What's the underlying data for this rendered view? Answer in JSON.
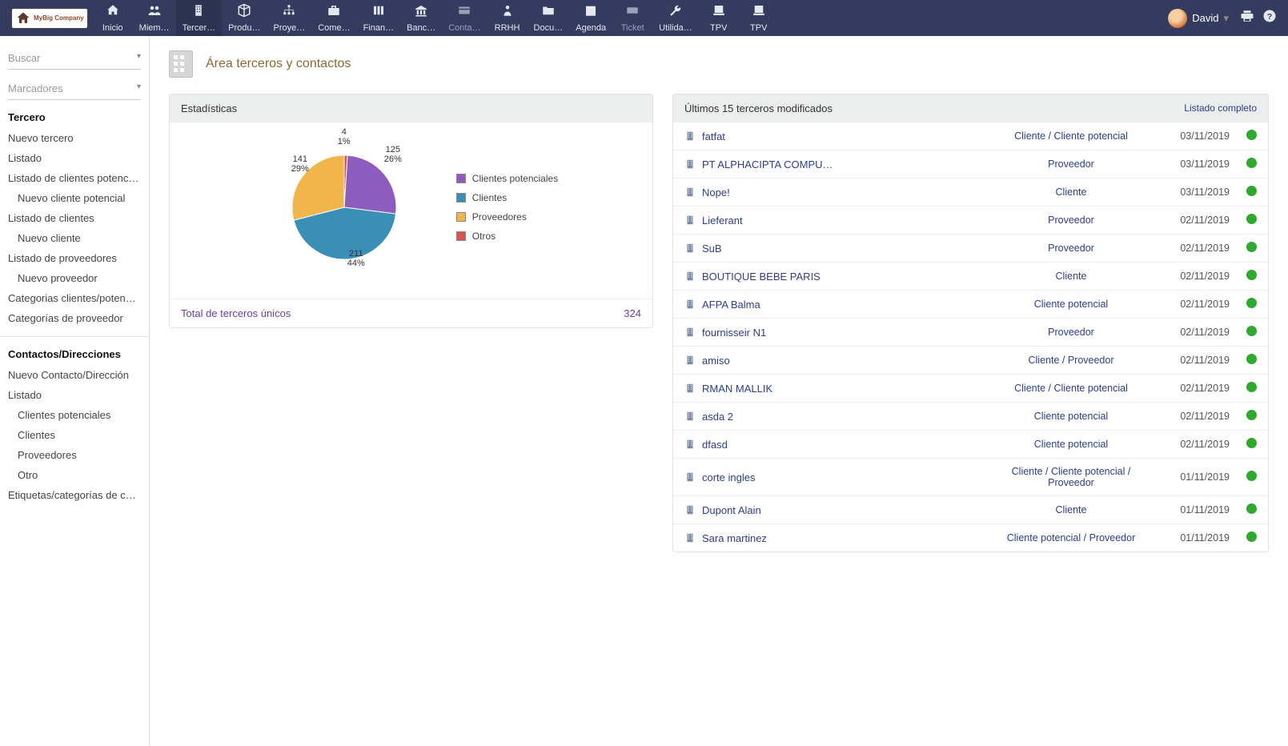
{
  "brand": "MyBig Company",
  "nav": [
    {
      "label": "Inicio",
      "icon": "home"
    },
    {
      "label": "Miem…",
      "icon": "users"
    },
    {
      "label": "Tercer…",
      "icon": "building",
      "active": true
    },
    {
      "label": "Produ…",
      "icon": "box"
    },
    {
      "label": "Proye…",
      "icon": "sitemap"
    },
    {
      "label": "Come…",
      "icon": "briefcase"
    },
    {
      "label": "Finan…",
      "icon": "books"
    },
    {
      "label": "Banc…",
      "icon": "bank"
    },
    {
      "label": "Conta…",
      "icon": "card",
      "muted": true
    },
    {
      "label": "RRHH",
      "icon": "usertie"
    },
    {
      "label": "Docu…",
      "icon": "folder"
    },
    {
      "label": "Agenda",
      "icon": "calendar"
    },
    {
      "label": "Ticket",
      "icon": "ticket",
      "muted": true
    },
    {
      "label": "Utilida…",
      "icon": "wrench"
    },
    {
      "label": "TPV",
      "icon": "register"
    },
    {
      "label": "TPV",
      "icon": "register"
    }
  ],
  "user": {
    "name": "David"
  },
  "search": {
    "placeholder": "Buscar"
  },
  "bookmarks": {
    "placeholder": "Marcadores"
  },
  "sidebar": {
    "groups": [
      {
        "head": "Tercero",
        "items": [
          {
            "label": "Nuevo tercero"
          },
          {
            "label": "Listado"
          },
          {
            "label": "Listado de clientes potenci…"
          },
          {
            "label": "Nuevo cliente potencial",
            "indent": true
          },
          {
            "label": "Listado de clientes"
          },
          {
            "label": "Nuevo cliente",
            "indent": true
          },
          {
            "label": "Listado de proveedores"
          },
          {
            "label": "Nuevo proveedor",
            "indent": true
          },
          {
            "label": "Categorias clientes/potenci…"
          },
          {
            "label": "Categorías de proveedor"
          }
        ]
      },
      {
        "head": "Contactos/Direcciones",
        "items": [
          {
            "label": "Nuevo Contacto/Dirección"
          },
          {
            "label": "Listado"
          },
          {
            "label": "Clientes potenciales",
            "indent": true
          },
          {
            "label": "Clientes",
            "indent": true
          },
          {
            "label": "Proveedores",
            "indent": true
          },
          {
            "label": "Otro",
            "indent": true
          },
          {
            "label": "Etiquetas/categorías de co…"
          }
        ]
      }
    ]
  },
  "page_title": "Área terceros y contactos",
  "stats": {
    "header": "Estadísticas",
    "legend": [
      {
        "label": "Clientes potenciales",
        "color": "#8e5bbf"
      },
      {
        "label": "Clientes",
        "color": "#3a8fb7"
      },
      {
        "label": "Proveedores",
        "color": "#f2b54a"
      },
      {
        "label": "Otros",
        "color": "#d9534f"
      }
    ],
    "total_label": "Total de terceros únicos",
    "total_value": "324"
  },
  "chart_data": {
    "type": "pie",
    "series": [
      {
        "name": "Clientes potenciales",
        "value": 125,
        "pct": 26,
        "color": "#8e5bbf"
      },
      {
        "name": "Clientes",
        "value": 211,
        "pct": 44,
        "color": "#3a8fb7"
      },
      {
        "name": "Proveedores",
        "value": 141,
        "pct": 29,
        "color": "#f2b54a"
      },
      {
        "name": "Otros",
        "value": 4,
        "pct": 1,
        "color": "#d9534f"
      }
    ],
    "labels": {
      "potenciales": {
        "v": "125",
        "p": "26%"
      },
      "clientes": {
        "v": "211",
        "p": "44%"
      },
      "proveedores": {
        "v": "141",
        "p": "29%"
      },
      "otros": {
        "v": "4",
        "p": "1%"
      }
    }
  },
  "recent": {
    "header": "Últimos 15 terceros modificados",
    "full_list": "Listado completo",
    "rows": [
      {
        "name": "fatfat",
        "type": "Cliente / Cliente potencial",
        "date": "03/11/2019"
      },
      {
        "name": "PT ALPHACIPTA COMPUT…",
        "type": "Proveedor",
        "date": "03/11/2019"
      },
      {
        "name": "Nope!",
        "type": "Cliente",
        "date": "03/11/2019"
      },
      {
        "name": "Lieferant",
        "type": "Proveedor",
        "date": "02/11/2019"
      },
      {
        "name": "SuB",
        "type": "Proveedor",
        "date": "02/11/2019"
      },
      {
        "name": "BOUTIQUE BEBE PARIS",
        "type": "Cliente",
        "date": "02/11/2019"
      },
      {
        "name": "AFPA Balma",
        "type": "Cliente potencial",
        "date": "02/11/2019"
      },
      {
        "name": "fournisseir N1",
        "type": "Proveedor",
        "date": "02/11/2019"
      },
      {
        "name": "amiso",
        "type": "Cliente / Proveedor",
        "date": "02/11/2019"
      },
      {
        "name": "RMAN MALLIK",
        "type": "Cliente / Cliente potencial",
        "date": "02/11/2019"
      },
      {
        "name": "asda 2",
        "type": "Cliente potencial",
        "date": "02/11/2019"
      },
      {
        "name": "dfasd",
        "type": "Cliente potencial",
        "date": "02/11/2019"
      },
      {
        "name": "corte ingles",
        "type": "Cliente / Cliente potencial / Proveedor",
        "date": "01/11/2019"
      },
      {
        "name": "Dupont Alain",
        "type": "Cliente",
        "date": "01/11/2019"
      },
      {
        "name": "Sara martinez",
        "type": "Cliente potencial / Proveedor",
        "date": "01/11/2019"
      }
    ]
  }
}
